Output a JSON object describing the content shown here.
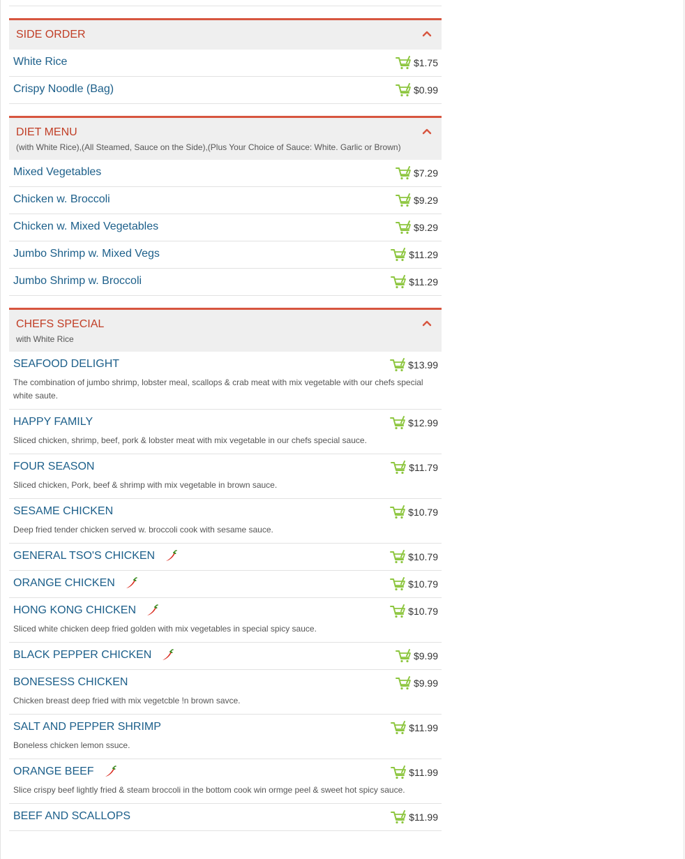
{
  "categories": [
    {
      "title": "SIDE ORDER",
      "subtitle": "",
      "items": [
        {
          "name": "White Rice",
          "price": "$1.75",
          "desc": "",
          "spicy": false
        },
        {
          "name": "Crispy Noodle (Bag)",
          "price": "$0.99",
          "desc": "",
          "spicy": false
        }
      ]
    },
    {
      "title": "DIET MENU",
      "subtitle": "(with White Rice),(All Steamed, Sauce on the Side),(Plus Your Choice of Sauce: White. Garlic or Brown)",
      "items": [
        {
          "name": "Mixed Vegetables",
          "price": "$7.29",
          "desc": "",
          "spicy": false
        },
        {
          "name": "Chicken w. Broccoli",
          "price": "$9.29",
          "desc": "",
          "spicy": false
        },
        {
          "name": "Chicken w. Mixed Vegetables",
          "price": "$9.29",
          "desc": "",
          "spicy": false
        },
        {
          "name": "Jumbo Shrimp w. Mixed Vegs",
          "price": "$11.29",
          "desc": "",
          "spicy": false
        },
        {
          "name": "Jumbo Shrimp w. Broccoli",
          "price": "$11.29",
          "desc": "",
          "spicy": false
        }
      ]
    },
    {
      "title": "CHEFS SPECIAL",
      "subtitle": "with White Rice",
      "items": [
        {
          "name": "SEAFOOD DELIGHT",
          "price": "$13.99",
          "desc": "The combination of jumbo shrimp, lobster meal, scallops & crab meat with mix vegetable with our chefs special white saute.",
          "spicy": false
        },
        {
          "name": "HAPPY FAMILY",
          "price": "$12.99",
          "desc": "Sliced chicken, shrimp, beef, pork & lobster meat with mix vegetable in our chefs special sauce.",
          "spicy": false
        },
        {
          "name": "FOUR SEASON",
          "price": "$11.79",
          "desc": "Sliced chicken, Pork, beef & shrimp with mix vegetable in brown sauce.",
          "spicy": false
        },
        {
          "name": "SESAME CHICKEN",
          "price": "$10.79",
          "desc": "Deep fried tender chicken served w. broccoli cook with sesame sauce.",
          "spicy": false
        },
        {
          "name": "GENERAL TSO'S CHICKEN",
          "price": "$10.79",
          "desc": "",
          "spicy": true
        },
        {
          "name": "ORANGE CHICKEN",
          "price": "$10.79",
          "desc": "",
          "spicy": true
        },
        {
          "name": "HONG KONG CHICKEN",
          "price": "$10.79",
          "desc": "Sliced white chicken deep fried golden with mix vegetables in special spicy sauce.",
          "spicy": true
        },
        {
          "name": "BLACK PEPPER CHICKEN",
          "price": "$9.99",
          "desc": "",
          "spicy": true
        },
        {
          "name": "BONESESS CHICKEN",
          "price": "$9.99",
          "desc": "Chicken breast deep fried with mix vegetcble !n brown savce.",
          "spicy": false
        },
        {
          "name": "SALT AND PEPPER SHRIMP",
          "price": "$11.99",
          "desc": "Boneless chicken lemon ssuce.",
          "spicy": false
        },
        {
          "name": "ORANGE BEEF",
          "price": "$11.99",
          "desc": "Slice crispy beef lightly fried & steam broccoli in the bottom cook win ormge peel & sweet hot spicy sauce.",
          "spicy": true
        },
        {
          "name": "BEEF AND SCALLOPS",
          "price": "$11.99",
          "desc": "",
          "spicy": false
        }
      ]
    }
  ],
  "icons": {
    "cart": "shopping-cart-icon",
    "spicy": "chili-pepper-icon",
    "collapse": "chevron-up-icon"
  },
  "colors": {
    "accent": "#d7553f",
    "category_title": "#c13e26",
    "item_name": "#1c5f8a",
    "cart": "#8dc63f",
    "header_bg": "#efefef"
  }
}
